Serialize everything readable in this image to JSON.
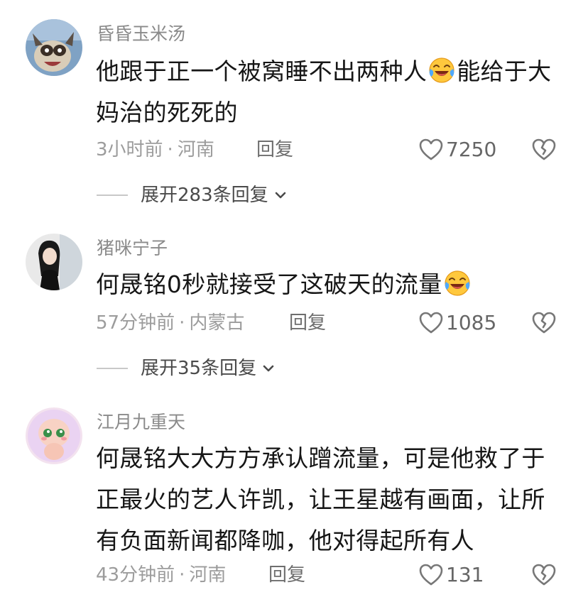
{
  "comments": [
    {
      "username": "昏昏玉米汤",
      "text_line1": "他跟于正一个被窝睡不出两种人",
      "text_line1_after_emoji": "能给于大",
      "text_line2": "妈治的死死的",
      "emoji": "laughing-crying-emoji",
      "time": "3小时前",
      "location": "河南",
      "reply_label": "回复",
      "likes": "7250",
      "expand_label": "展开283条回复"
    },
    {
      "username": "猪咪宁子",
      "text_line1": "何晟铭0秒就接受了这破天的流量",
      "emoji": "laughing-crying-emoji",
      "time": "57分钟前",
      "location": "内蒙古",
      "reply_label": "回复",
      "likes": "1085",
      "expand_label": "展开35条回复"
    },
    {
      "username": "江月九重天",
      "text_line1": "何晟铭大大方方承认蹭流量，可是他救了于",
      "text_line2": "正最火的艺人许凯，让王星越有画面，让所",
      "text_line3": "有负面新闻都降咖，他对得起所有人",
      "time": "43分钟前",
      "location": "河南",
      "reply_label": "回复",
      "likes": "131"
    }
  ],
  "separator": "·",
  "icons": {
    "like": "heart-outline-icon",
    "dislike": "broken-heart-icon",
    "expand": "chevron-down-icon"
  },
  "colors": {
    "username": "#8a8a8a",
    "text": "#161616",
    "meta": "#9c9c9c"
  }
}
